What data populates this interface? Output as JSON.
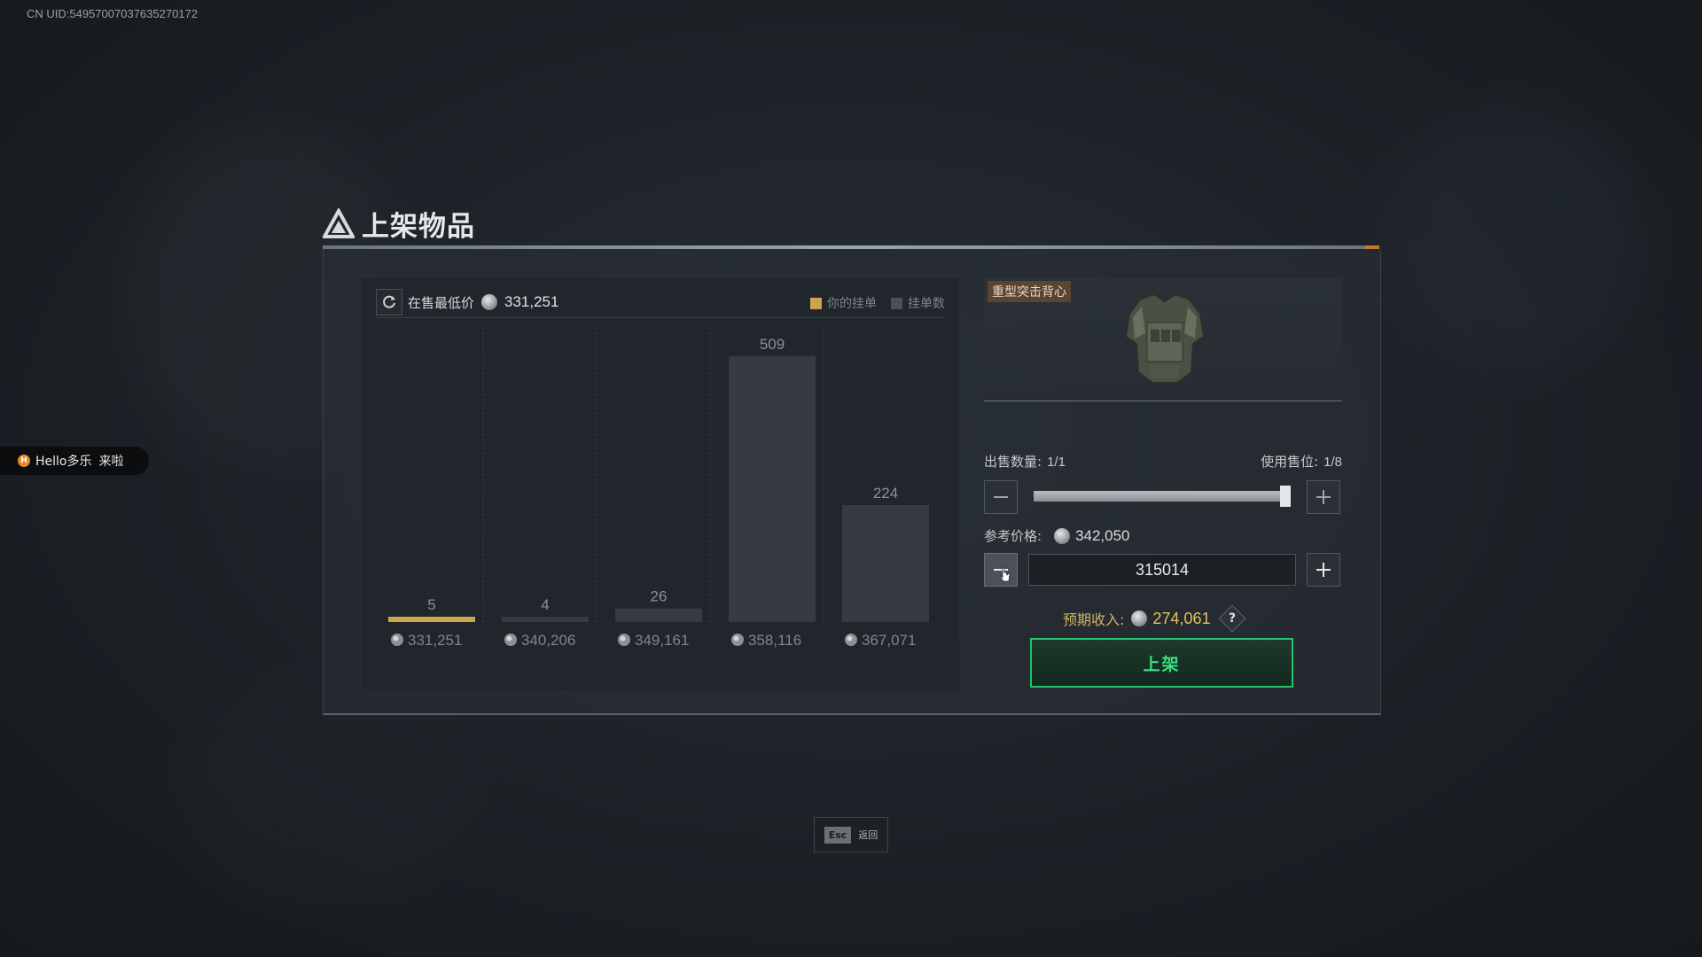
{
  "uid": "CN UID:54957007037635270172",
  "notification": {
    "badge": "H",
    "user": "Hello多乐",
    "message": "来啦"
  },
  "title": "上架物品",
  "chart": {
    "lowest_label": "在售最低价",
    "lowest_price": "331,251",
    "legend": {
      "yours": "你的挂单",
      "count": "挂单数"
    }
  },
  "chart_data": {
    "type": "bar",
    "categories": [
      "331,251",
      "340,206",
      "349,161",
      "358,116",
      "367,071"
    ],
    "values": [
      5,
      4,
      26,
      509,
      224
    ],
    "highlight_index": 0,
    "colors": {
      "yours": "#c8a84a",
      "count": "#3a4046"
    }
  },
  "item": {
    "name": "重型突击背心"
  },
  "quantity": {
    "label": "出售数量:",
    "value": "1/1",
    "slots_label": "使用售位:",
    "slots_value": "1/8",
    "slider_fraction": 1.0
  },
  "reference": {
    "label": "参考价格:",
    "price": "342,050"
  },
  "price_input": {
    "value": "315014"
  },
  "income": {
    "label": "预期收入:",
    "amount": "274,061",
    "help": "?"
  },
  "list_button": {
    "label": "上架"
  },
  "esc": {
    "key": "Esc",
    "label": "返回"
  },
  "colors": {
    "accent_green": "#25c26b",
    "gold": "#e0c25e",
    "badge_brown": "#5a4434"
  }
}
